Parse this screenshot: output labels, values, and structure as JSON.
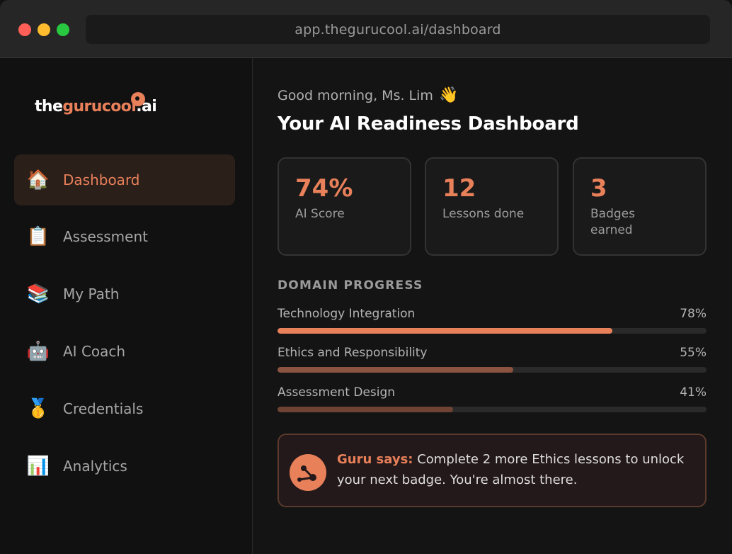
{
  "browser": {
    "url": "app.thegurucool.ai/dashboard"
  },
  "logo": {
    "part1": "the",
    "part2": "gurucool",
    "part3": ".ai"
  },
  "sidebar": {
    "items": [
      {
        "label": "Dashboard",
        "icon": "house-icon",
        "glyph": "🏠",
        "active": true
      },
      {
        "label": "Assessment",
        "icon": "clipboard-icon",
        "glyph": "📋",
        "active": false
      },
      {
        "label": "My Path",
        "icon": "books-icon",
        "glyph": "📚",
        "active": false
      },
      {
        "label": "AI Coach",
        "icon": "robot-icon",
        "glyph": "🤖",
        "active": false
      },
      {
        "label": "Credentials",
        "icon": "medal-icon",
        "glyph": "🥇",
        "active": false
      },
      {
        "label": "Analytics",
        "icon": "bar-chart-icon",
        "glyph": "📊",
        "active": false
      }
    ]
  },
  "header": {
    "greeting": "Good morning, Ms. Lim",
    "wave": "👋",
    "title": "Your AI Readiness Dashboard"
  },
  "stats": [
    {
      "value": "74%",
      "label": "AI Score"
    },
    {
      "value": "12",
      "label": "Lessons done"
    },
    {
      "value": "3",
      "label": "Badges earned"
    }
  ],
  "domain_progress": {
    "title": "DOMAIN PROGRESS",
    "items": [
      {
        "name": "Technology Integration",
        "percent_label": "78%",
        "value": 78,
        "color": "#e8805a"
      },
      {
        "name": "Ethics and Responsibility",
        "percent_label": "55%",
        "value": 55,
        "color": "#8c5440"
      },
      {
        "name": "Assessment Design",
        "percent_label": "41%",
        "value": 41,
        "color": "#6e4334"
      }
    ]
  },
  "coach_tip": {
    "prefix": "Guru says:",
    "message": " Complete 2 more Ethics lessons to unlock your next badge. You're almost there."
  },
  "colors": {
    "accent": "#e8805a",
    "background": "#141414",
    "sidebar_active": "#2b1f1a"
  }
}
